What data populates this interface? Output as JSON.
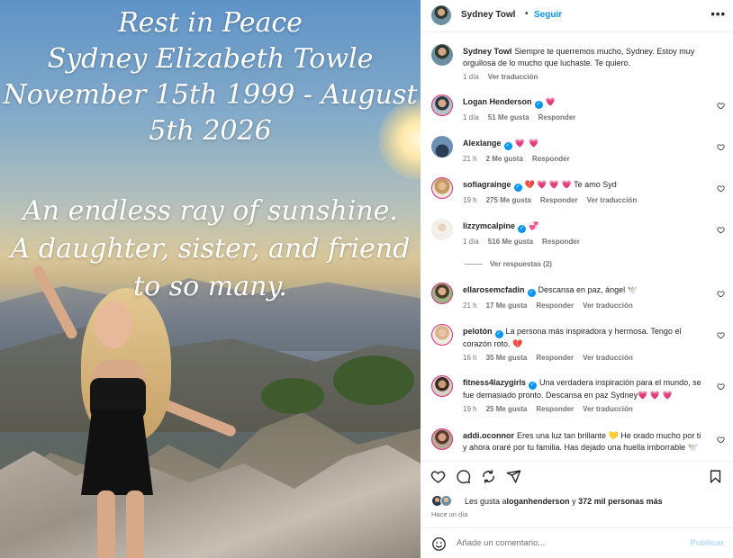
{
  "post_image": {
    "overlay_lines": [
      "Rest in Peace",
      "Sydney Elizabeth Towle",
      "November 15th 1999 - August",
      "5th 2026",
      "An endless ray of sunshine.",
      "A daughter, sister, and friend",
      "to so many."
    ]
  },
  "header": {
    "username": "Sydney Towl",
    "dot": "•",
    "follow_label": "Seguir",
    "more_label": "•••"
  },
  "caption": {
    "username": "Sydney Towl",
    "text": "Siempre te querremos mucho, Sydney. Estoy muy orgullosa de lo mucho que luchaste. Te quiero.",
    "time": "1 día",
    "translate": "Ver traducción"
  },
  "comments": [
    {
      "username": "Logan Henderson",
      "verified": true,
      "text": "💗",
      "time": "1 día",
      "likes": "51 Me gusta",
      "reply": "Responder",
      "translate": ""
    },
    {
      "username": "Alexlange",
      "verified": true,
      "text": "💗 💗",
      "time": "21 h",
      "likes": "2 Me gusta",
      "reply": "Responder",
      "translate": ""
    },
    {
      "username": "sofiagrainge",
      "verified": true,
      "text": "💔 💗 💗 💗 Te amo Syd",
      "time": "19 h",
      "likes": "275 Me gusta",
      "reply": "Responder",
      "translate": "Ver traducción"
    },
    {
      "username": "lizzymcalpine",
      "verified": true,
      "text": "💞",
      "time": "1 día",
      "likes": "516 Me gusta",
      "reply": "Responder",
      "translate": ""
    },
    {
      "username": "ellarosemcfadin",
      "verified": true,
      "text": "Descansa en paz, ángel 🕊️",
      "time": "21 h",
      "likes": "17 Me gusta",
      "reply": "Responder",
      "translate": "Ver traducción"
    },
    {
      "username": "pelotón",
      "verified": true,
      "text": "La persona más inspiradora y hermosa. Tengo el corazón roto. 💔",
      "time": "16 h",
      "likes": "35 Me gusta",
      "reply": "Responder",
      "translate": "Ver traducción"
    },
    {
      "username": "fitness4lazygirls",
      "verified": true,
      "text": "Una verdadera inspiración para el mundo, se fue demasiado pronto. Descansa en paz Sydney💗 💗 💗",
      "time": "19 h",
      "likes": "25 Me gusta",
      "reply": "Responder",
      "translate": "Ver traducción"
    },
    {
      "username": "addi.oconnor",
      "verified": false,
      "text": "Eres una luz tan brillante 💛 He orado mucho por ti y ahora oraré por tu familia. Has dejado una huella imborrable 🕊️",
      "time": "",
      "likes": "",
      "reply": "",
      "translate": ""
    }
  ],
  "view_replies": "Ver respuestas (2)",
  "likes": {
    "prefix": "Les gusta a",
    "user": "loganhenderson",
    "middle": " y ",
    "count": "372 mil personas más"
  },
  "posted_time": "Hace un día",
  "add_comment": {
    "placeholder": "Añade un comentario...",
    "publish": "Publicar"
  },
  "colors": {
    "accent": "#0095f6",
    "publish_disabled": "#b3dbff",
    "story_ring": "#dd2a7b"
  },
  "icons": [
    "heart-icon",
    "comment-icon",
    "share-icon",
    "send-icon",
    "bookmark-icon",
    "emoji-icon",
    "more-icon",
    "verified-icon"
  ]
}
